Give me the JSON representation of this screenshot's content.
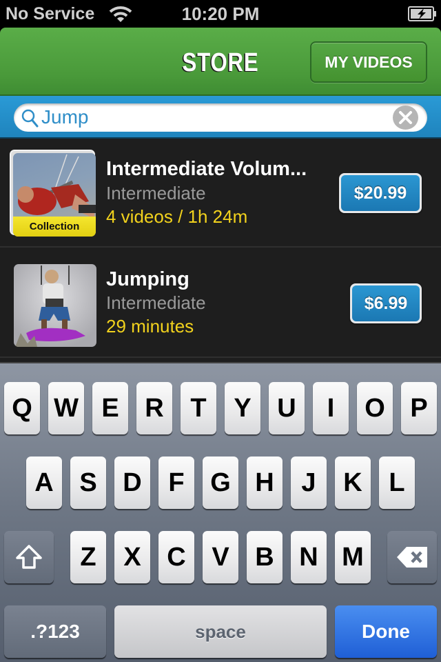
{
  "status_bar": {
    "carrier": "No Service",
    "time": "10:20 PM",
    "wifi_icon": "wifi-icon",
    "battery_icon": "battery-charging-icon"
  },
  "nav": {
    "title": "STORE",
    "my_videos_label": "MY VIDEOS",
    "color": "#4e9f3d"
  },
  "search": {
    "value": "Jump",
    "icon": "search-icon",
    "clear_icon": "clear-icon",
    "color": "#2693cf"
  },
  "results": [
    {
      "title": "Intermediate Volum...",
      "level": "Intermediate",
      "meta": "4 videos / 1h 24m",
      "price": "$20.99",
      "badge": "Collection",
      "thumbnail": "kiteboarder-thumbnail"
    },
    {
      "title": "Jumping",
      "level": "Intermediate",
      "meta": "29 minutes",
      "price": "$6.99",
      "thumbnail": "kiteboarder-thumbnail"
    }
  ],
  "keyboard": {
    "row1": [
      "Q",
      "W",
      "E",
      "R",
      "T",
      "Y",
      "U",
      "I",
      "O",
      "P"
    ],
    "row2": [
      "A",
      "S",
      "D",
      "F",
      "G",
      "H",
      "J",
      "K",
      "L"
    ],
    "row3": [
      "Z",
      "X",
      "C",
      "V",
      "B",
      "N",
      "M"
    ],
    "numbers_label": ".?123",
    "space_label": "space",
    "done_label": "Done",
    "shift_icon": "shift-icon",
    "delete_icon": "delete-icon"
  },
  "colors": {
    "price_button": "#2389c4",
    "meta_text": "#f2d21d",
    "done_key": "#2f74e2"
  }
}
